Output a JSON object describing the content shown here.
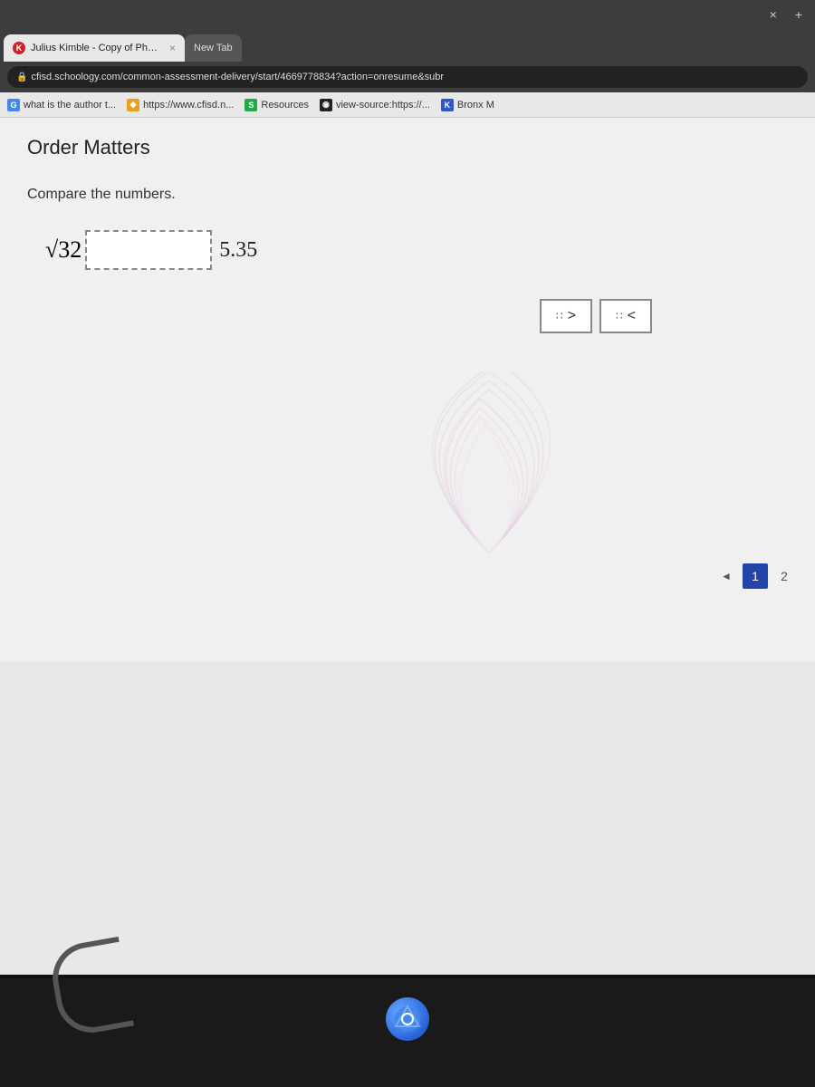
{
  "browser": {
    "tabs": [
      {
        "id": "tab-julius",
        "label": "Julius Kimble - Copy of Phoeni",
        "favicon_type": "k-red",
        "active": true,
        "has_close": true,
        "close_symbol": "×"
      },
      {
        "id": "tab-new",
        "label": "New Tab",
        "favicon_type": "none",
        "active": false,
        "has_close": false,
        "close_symbol": ""
      }
    ],
    "title_bar_buttons": [
      "×",
      "+"
    ],
    "address": "cfisd.schoology.com/common-assessment-delivery/start/4669778834?action=onresume&subr",
    "lock_icon": "🔒",
    "bookmarks": [
      {
        "label": "what is the author t...",
        "favicon": "G",
        "color": "google"
      },
      {
        "label": "https://www.cfisd.n...",
        "favicon": "◆",
        "color": "orange"
      },
      {
        "label": "Resources",
        "favicon": "S",
        "color": "green"
      },
      {
        "label": "view-source:https://...",
        "favicon": "◉",
        "color": "dark"
      },
      {
        "label": "Bronx M",
        "favicon": "K",
        "color": "blue"
      }
    ]
  },
  "page": {
    "title": "Order Matters",
    "question": "Compare the numbers.",
    "math": {
      "left_expression": "√32",
      "answer_placeholder": "",
      "right_value": "5.35"
    },
    "operators": [
      {
        "label": ">",
        "id": "op-greater"
      },
      {
        "label": "<",
        "id": "op-less"
      }
    ],
    "operator_dots": "∷",
    "pagination": {
      "prev_label": "◄",
      "pages": [
        "1",
        "2"
      ],
      "current_page": "1"
    }
  },
  "taskbar": {
    "icon_alt": "Chrome browser icon"
  }
}
